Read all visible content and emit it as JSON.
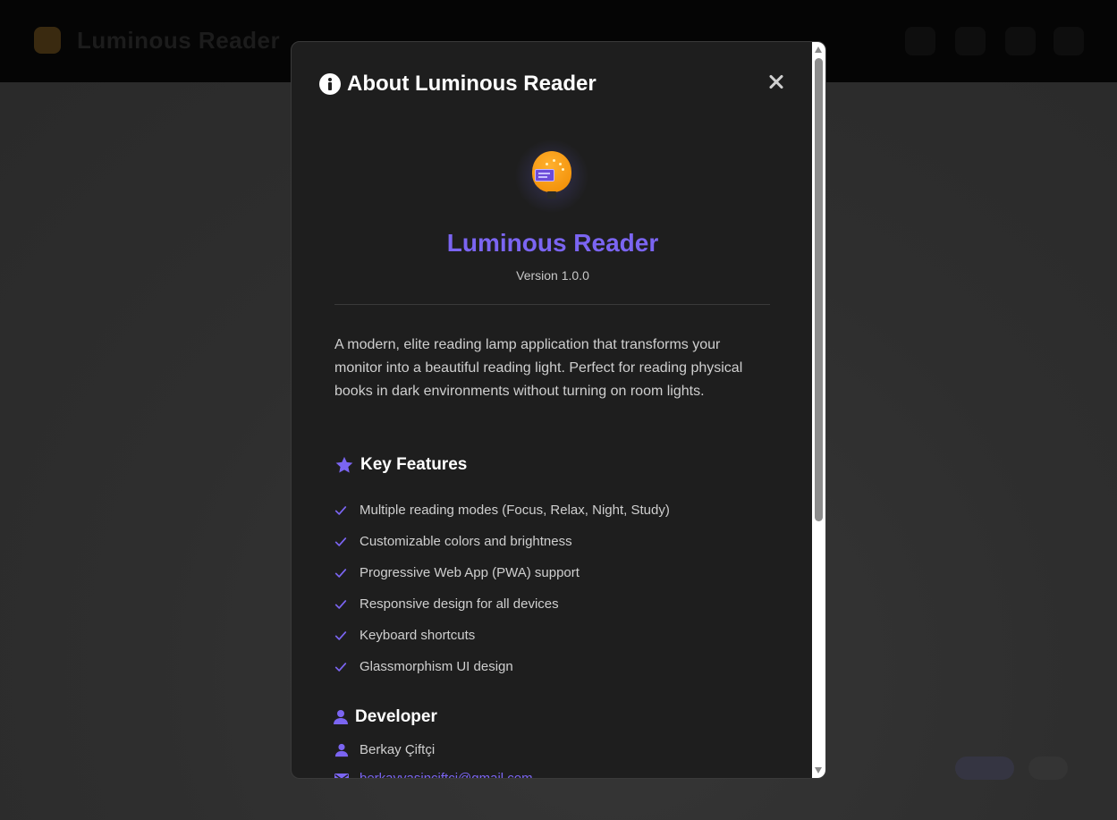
{
  "background": {
    "app_title": "Luminous Reader"
  },
  "modal": {
    "title": "About Luminous Reader",
    "close_icon": "close-icon",
    "app_name": "Luminous Reader",
    "version": "Version 1.0.0",
    "description": "A modern, elite reading lamp application that transforms your monitor into a beautiful reading light. Perfect for reading physical books in dark environments without turning on room lights.",
    "features_title": "Key Features",
    "features": [
      "Multiple reading modes (Focus, Relax, Night, Study)",
      "Customizable colors and brightness",
      "Progressive Web App (PWA) support",
      "Responsive design for all devices",
      "Keyboard shortcuts",
      "Glassmorphism UI design"
    ],
    "developer_title": "Developer",
    "developer_name": "Berkay Çiftçi",
    "developer_email": "berkayyasinciftci@gmail.com"
  },
  "colors": {
    "accent": "#7b65f2",
    "lamp": "#f59a0c",
    "modal_bg": "#1e1e1e"
  }
}
